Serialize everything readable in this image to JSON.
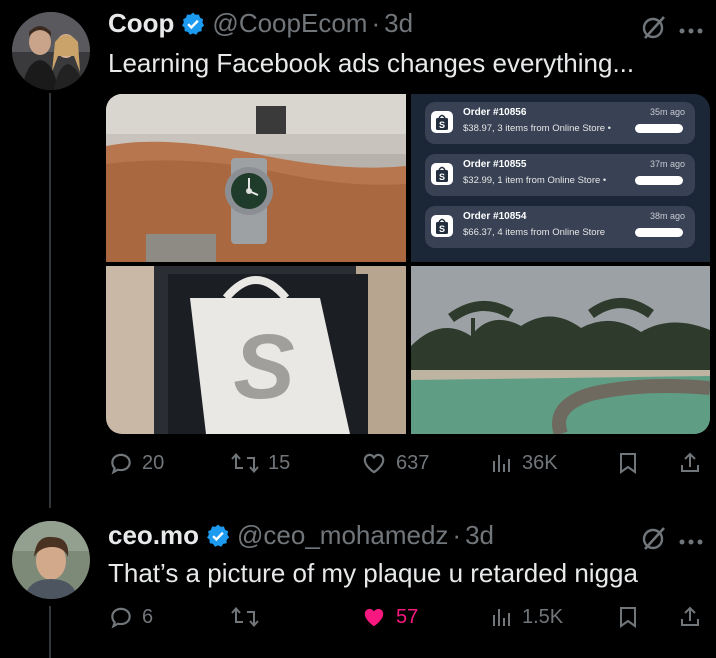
{
  "tweets": [
    {
      "display_name": "Coop",
      "handle": "@CoopEcom",
      "time": "3d",
      "text": "Learning Facebook ads changes everything...",
      "stats": {
        "replies": "20",
        "reposts": "15",
        "likes": "637",
        "views": "36K"
      },
      "media": {
        "orders": [
          {
            "title": "Order #10856",
            "detail": "$38.97, 3 items from Online Store •",
            "ago": "35m ago"
          },
          {
            "title": "Order #10855",
            "detail": "$32.99, 1 item from Online Store •",
            "ago": "37m ago"
          },
          {
            "title": "Order #10854",
            "detail": "$66.37, 4 items from Online Store",
            "ago": "38m ago"
          }
        ]
      }
    },
    {
      "display_name": "ceo.mo",
      "handle": "@ceo_mohamedz",
      "time": "3d",
      "text": "That’s a picture of my plaque u retarded nigga",
      "stats": {
        "replies": "6",
        "reposts": "",
        "likes": "57",
        "views": "1.5K"
      },
      "liked": true
    }
  ],
  "separator": "·",
  "colors": {
    "accent_blue": "#1d9bf0",
    "like_pink": "#f91880",
    "muted": "#71767b",
    "text": "#e7e9ea"
  },
  "icons": [
    "verified-badge-icon",
    "grok-icon",
    "more-icon",
    "reply-icon",
    "repost-icon",
    "like-icon",
    "views-icon",
    "bookmark-icon",
    "share-icon",
    "shopify-bag-icon"
  ]
}
